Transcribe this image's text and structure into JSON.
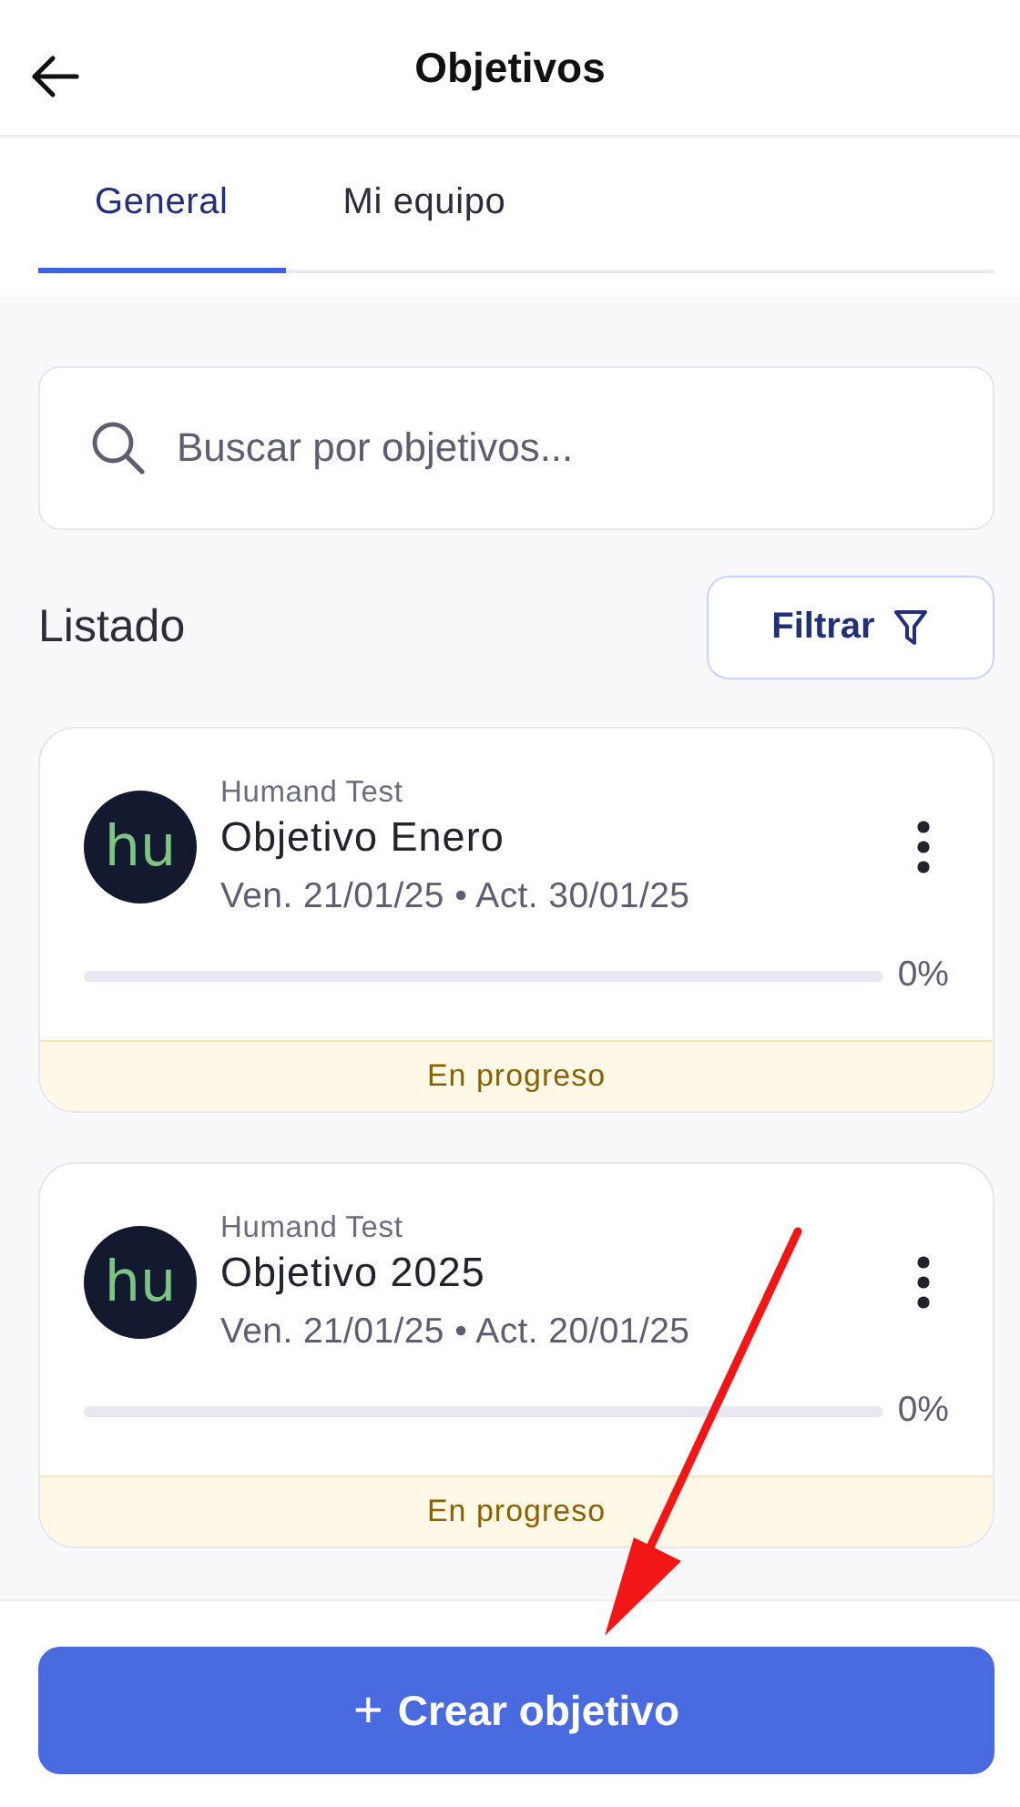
{
  "header": {
    "title": "Objetivos"
  },
  "tabs": [
    {
      "label": "General",
      "selected": true
    },
    {
      "label": "Mi equipo",
      "selected": false
    }
  ],
  "search": {
    "placeholder": "Buscar por objetivos..."
  },
  "list": {
    "title": "Listado",
    "filter_button": "Filtrar"
  },
  "objectives": [
    {
      "avatar": "hu",
      "owner": "Humand Test",
      "name": "Objetivo Enero",
      "dates": "Ven. 21/01/25 • Act. 30/01/25",
      "level": 0,
      "percent": "0%",
      "status": "En progreso"
    },
    {
      "avatar": "hu",
      "owner": "Humand Test",
      "name": "Objetivo 2025",
      "dates": "Ven. 21/01/25 • Act. 20/01/25",
      "level": 0,
      "percent": "0%",
      "status": "En progreso"
    }
  ],
  "create_button": {
    "icon": "+",
    "label": "Crear objetivo"
  },
  "annotation": {
    "kind": "arrow"
  }
}
